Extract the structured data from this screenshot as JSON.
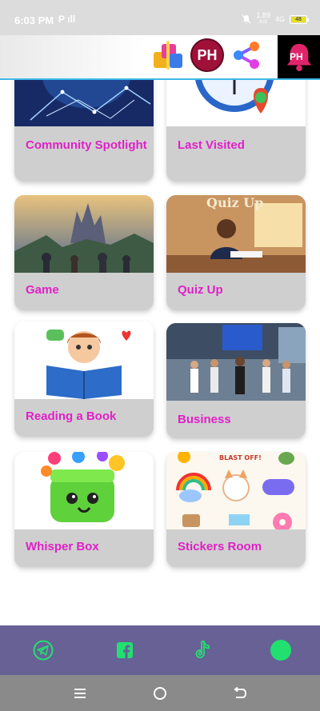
{
  "status_bar": {
    "time": "6:03 PM",
    "left_icons": "P ıll",
    "net_speed": "1.89",
    "net_unit": "K/S",
    "network": "4G",
    "battery": "48"
  },
  "header": {
    "icons": [
      "gifts-icon",
      "ph-badge-icon",
      "share-icon",
      "notification-bell-icon"
    ],
    "ph_label": "PH",
    "bell_label": "PH"
  },
  "cards": [
    {
      "label": "Community Spotlight",
      "image": "community-spotlight-image"
    },
    {
      "label": "Last Visited",
      "image": "last-visited-image"
    },
    {
      "label": "Game",
      "image": "game-image"
    },
    {
      "label": "Quiz Up",
      "image": "quiz-up-image",
      "image_text": "Quiz Up"
    },
    {
      "label": "Reading a Book",
      "image": "reading-book-image"
    },
    {
      "label": "Business",
      "image": "business-image"
    },
    {
      "label": "Whisper Box",
      "image": "whisper-box-image"
    },
    {
      "label": "Stickers Room",
      "image": "stickers-room-image",
      "image_text": "BLAST OFF!"
    }
  ],
  "bottom_nav": [
    "telegram-icon",
    "facebook-icon",
    "tiktok-icon",
    "profile-icon"
  ],
  "system_nav": [
    "menu-icon",
    "home-icon",
    "back-icon"
  ],
  "colors": {
    "accent": "#e020c8",
    "nav_bg": "#676196",
    "nav_icon": "#22e070",
    "header_line": "#3db8e8"
  }
}
